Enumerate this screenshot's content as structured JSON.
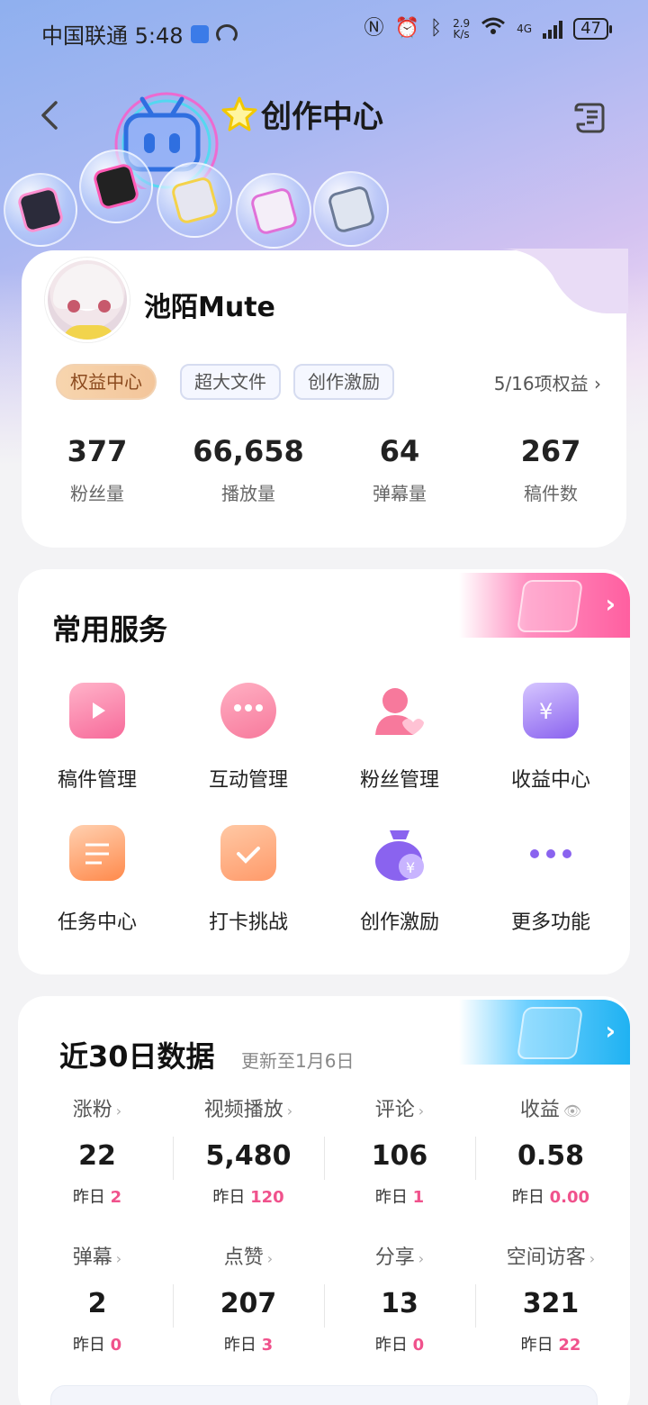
{
  "status_bar": {
    "carrier_time": "中国联通 5:48",
    "net_speed_top": "2.9",
    "net_speed_bottom": "K/s",
    "net_type": "4G",
    "battery": "47"
  },
  "header": {
    "title": "创作中心"
  },
  "profile": {
    "username": "池陌Mute",
    "tags": [
      "权益中心",
      "超大文件",
      "创作激励"
    ],
    "rights_summary": "5/16项权益 ›",
    "stats": [
      {
        "value": "377",
        "label": "粉丝量"
      },
      {
        "value": "66,658",
        "label": "播放量"
      },
      {
        "value": "64",
        "label": "弹幕量"
      },
      {
        "value": "267",
        "label": "稿件数"
      }
    ]
  },
  "services": {
    "title": "常用服务",
    "items": [
      {
        "label": "稿件管理",
        "icon": "video-doc-icon"
      },
      {
        "label": "互动管理",
        "icon": "chat-bubble-icon"
      },
      {
        "label": "粉丝管理",
        "icon": "fan-heart-icon"
      },
      {
        "label": "收益中心",
        "icon": "yen-card-icon"
      },
      {
        "label": "任务中心",
        "icon": "clipboard-icon"
      },
      {
        "label": "打卡挑战",
        "icon": "checkin-box-icon"
      },
      {
        "label": "创作激励",
        "icon": "money-bag-icon"
      },
      {
        "label": "更多功能",
        "icon": "more-dots-icon"
      }
    ]
  },
  "metrics": {
    "title": "近30日数据",
    "updated": "更新至1月6日",
    "yesterday_label": "昨日",
    "items": [
      {
        "key": "涨粉",
        "value": "22",
        "yesterday": "2"
      },
      {
        "key": "视频播放",
        "value": "5,480",
        "yesterday": "120"
      },
      {
        "key": "评论",
        "value": "106",
        "yesterday": "1"
      },
      {
        "key": "收益",
        "value": "0.58",
        "yesterday": "0.00"
      },
      {
        "key": "弹幕",
        "value": "2",
        "yesterday": "0"
      },
      {
        "key": "点赞",
        "value": "207",
        "yesterday": "3"
      },
      {
        "key": "分享",
        "value": "13",
        "yesterday": "0"
      },
      {
        "key": "空间访客",
        "value": "321",
        "yesterday": "22"
      }
    ]
  },
  "colors": {
    "accent_pink": "#f0528c",
    "gold_tag": "#f3c59a",
    "blue_ribbon": "#1fb2f2"
  }
}
